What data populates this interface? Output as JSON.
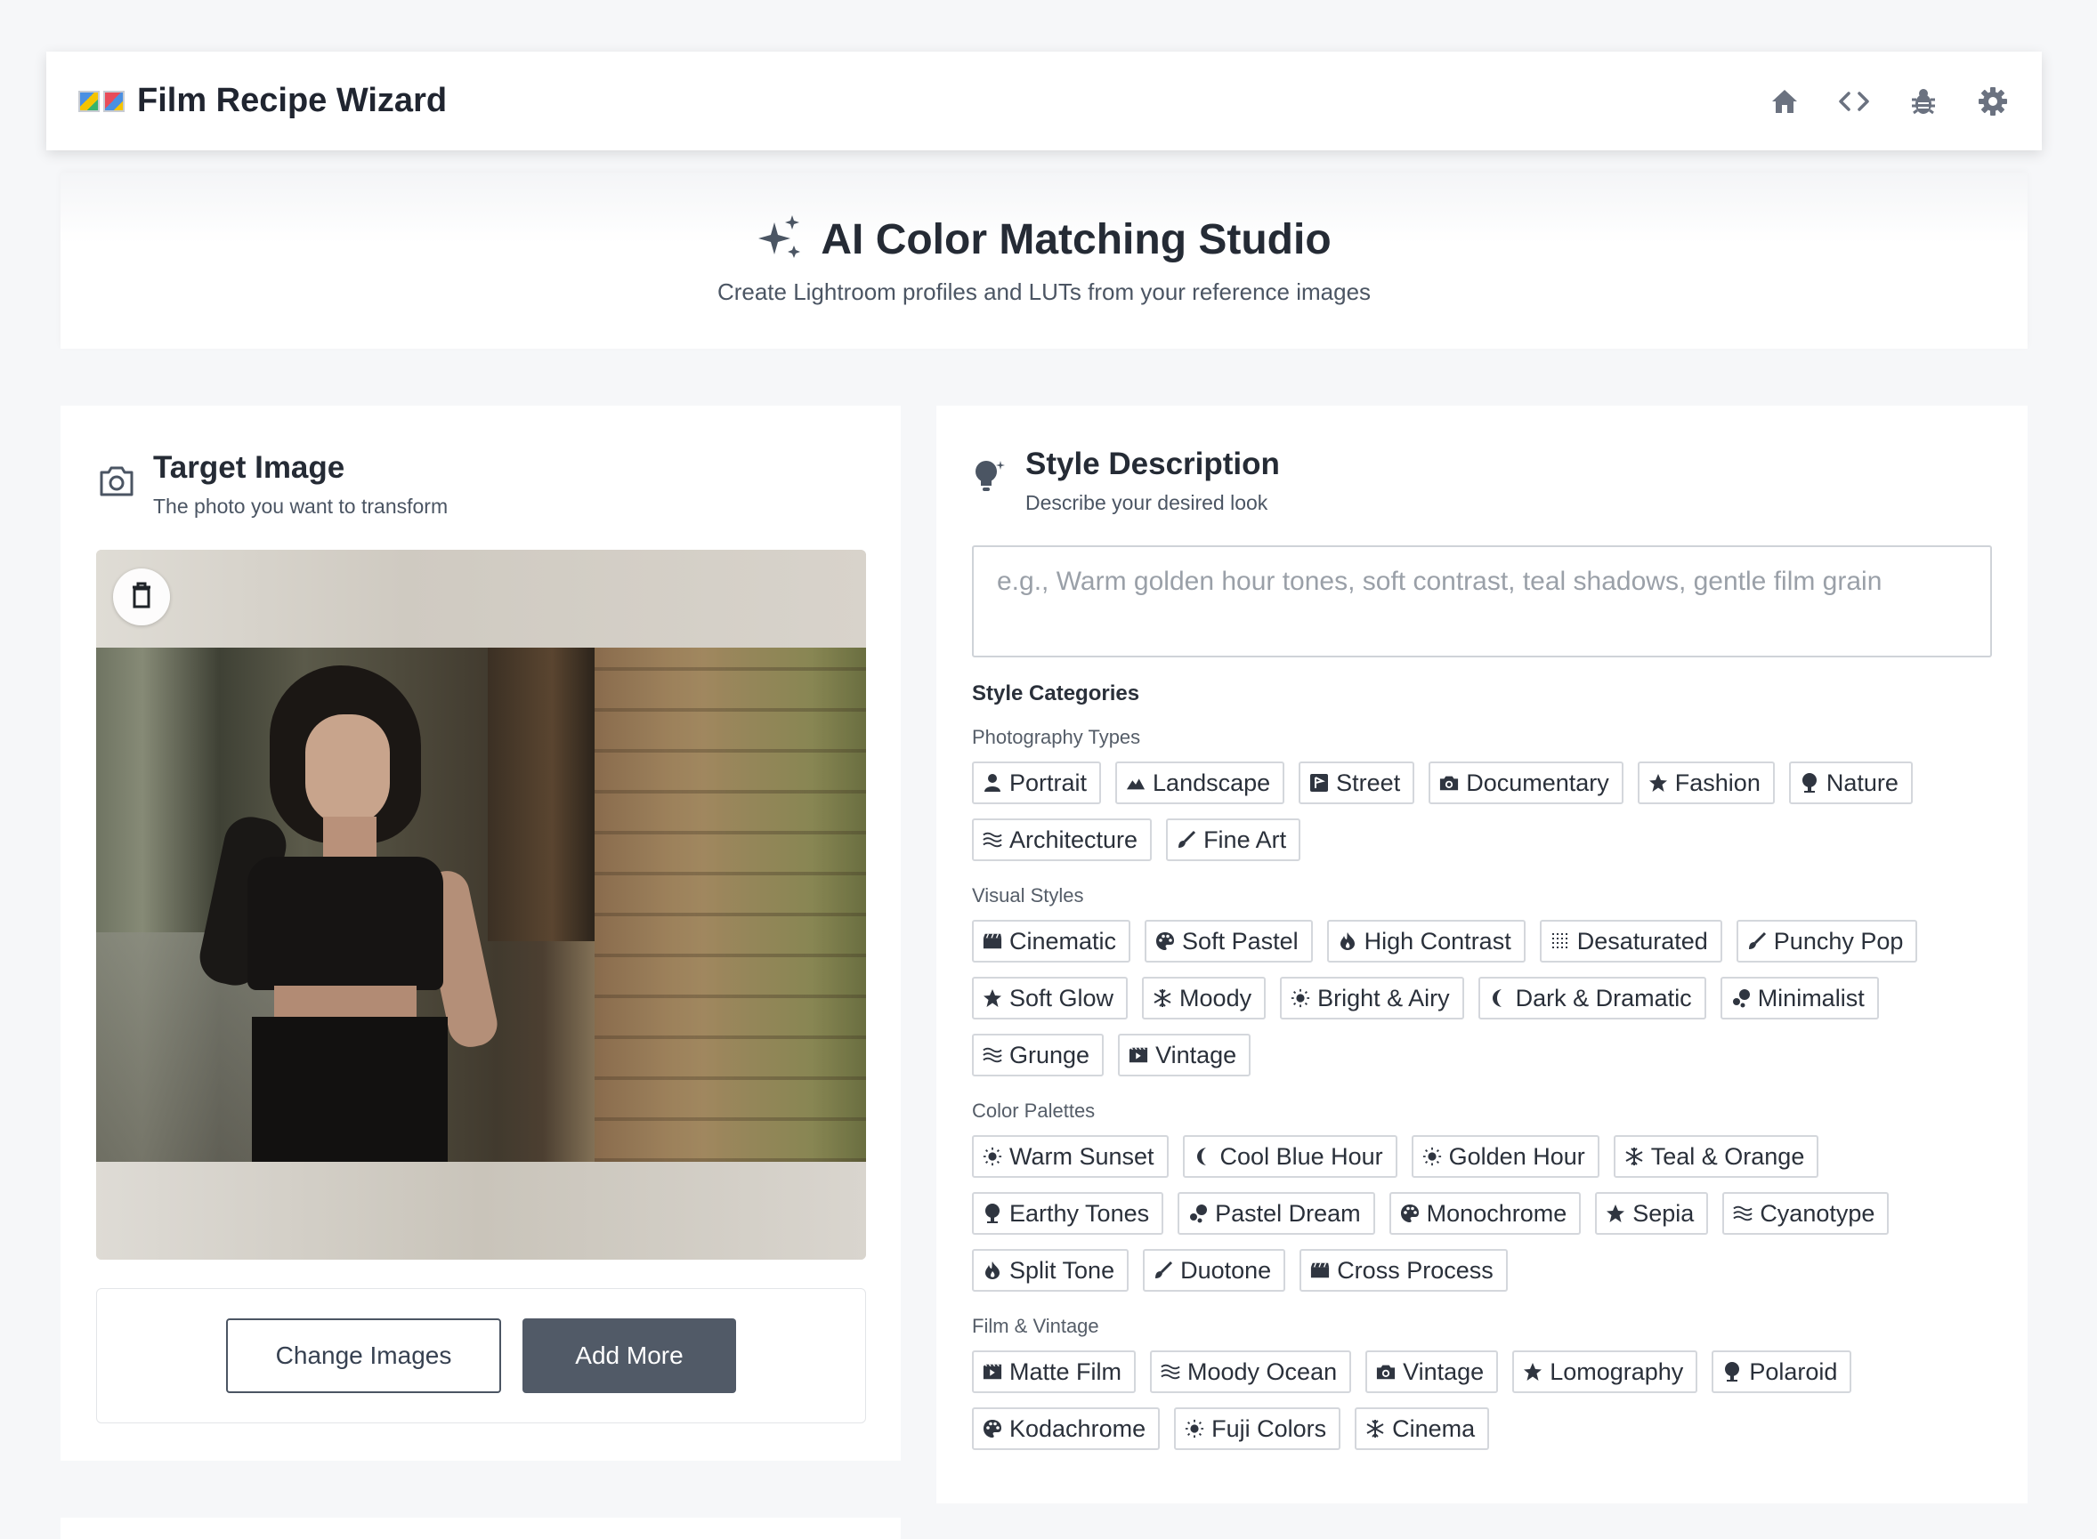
{
  "app": {
    "title": "Film Recipe Wizard"
  },
  "nav": [
    {
      "name": "home-icon"
    },
    {
      "name": "code-icon"
    },
    {
      "name": "bug-icon"
    },
    {
      "name": "gear-icon"
    }
  ],
  "hero": {
    "title": "AI Color Matching Studio",
    "subtitle": "Create Lightroom profiles and LUTs from your reference images"
  },
  "target": {
    "title": "Target Image",
    "subtitle": "The photo you want to transform",
    "change_label": "Change Images",
    "add_label": "Add More"
  },
  "style": {
    "title": "Style Description",
    "subtitle": "Describe your desired look",
    "placeholder": "e.g., Warm golden hour tones, soft contrast, teal shadows, gentle film grain",
    "categories_title": "Style Categories"
  },
  "groups": [
    {
      "title": "Photography Types",
      "chips": [
        {
          "label": "Portrait",
          "icon": "person"
        },
        {
          "label": "Landscape",
          "icon": "mountain"
        },
        {
          "label": "Street",
          "icon": "street"
        },
        {
          "label": "Documentary",
          "icon": "camera"
        },
        {
          "label": "Fashion",
          "icon": "star"
        },
        {
          "label": "Nature",
          "icon": "tree"
        },
        {
          "label": "Architecture",
          "icon": "waves"
        },
        {
          "label": "Fine Art",
          "icon": "brush"
        }
      ]
    },
    {
      "title": "Visual Styles",
      "chips": [
        {
          "label": "Cinematic",
          "icon": "clapper"
        },
        {
          "label": "Soft Pastel",
          "icon": "palette"
        },
        {
          "label": "High Contrast",
          "icon": "flame"
        },
        {
          "label": "Desaturated",
          "icon": "dots"
        },
        {
          "label": "Punchy Pop",
          "icon": "brush"
        },
        {
          "label": "Soft Glow",
          "icon": "star"
        },
        {
          "label": "Moody",
          "icon": "snow"
        },
        {
          "label": "Bright & Airy",
          "icon": "sun"
        },
        {
          "label": "Dark & Dramatic",
          "icon": "moon"
        },
        {
          "label": "Minimalist",
          "icon": "bubbles"
        },
        {
          "label": "Grunge",
          "icon": "waves"
        },
        {
          "label": "Vintage",
          "icon": "film"
        }
      ]
    },
    {
      "title": "Color Palettes",
      "chips": [
        {
          "label": "Warm Sunset",
          "icon": "sun"
        },
        {
          "label": "Cool Blue Hour",
          "icon": "moon"
        },
        {
          "label": "Golden Hour",
          "icon": "sun"
        },
        {
          "label": "Teal & Orange",
          "icon": "snow"
        },
        {
          "label": "Earthy Tones",
          "icon": "tree"
        },
        {
          "label": "Pastel Dream",
          "icon": "bubbles"
        },
        {
          "label": "Monochrome",
          "icon": "palette"
        },
        {
          "label": "Sepia",
          "icon": "star"
        },
        {
          "label": "Cyanotype",
          "icon": "waves"
        },
        {
          "label": "Split Tone",
          "icon": "flame"
        },
        {
          "label": "Duotone",
          "icon": "brush"
        },
        {
          "label": "Cross Process",
          "icon": "clapper"
        }
      ]
    },
    {
      "title": "Film & Vintage",
      "chips": [
        {
          "label": "Matte Film",
          "icon": "film"
        },
        {
          "label": "Moody Ocean",
          "icon": "waves"
        },
        {
          "label": "Vintage",
          "icon": "camera"
        },
        {
          "label": "Lomography",
          "icon": "star"
        },
        {
          "label": "Polaroid",
          "icon": "tree"
        },
        {
          "label": "Kodachrome",
          "icon": "palette"
        },
        {
          "label": "Fuji Colors",
          "icon": "sun"
        },
        {
          "label": "Cinema",
          "icon": "snow"
        }
      ]
    }
  ]
}
